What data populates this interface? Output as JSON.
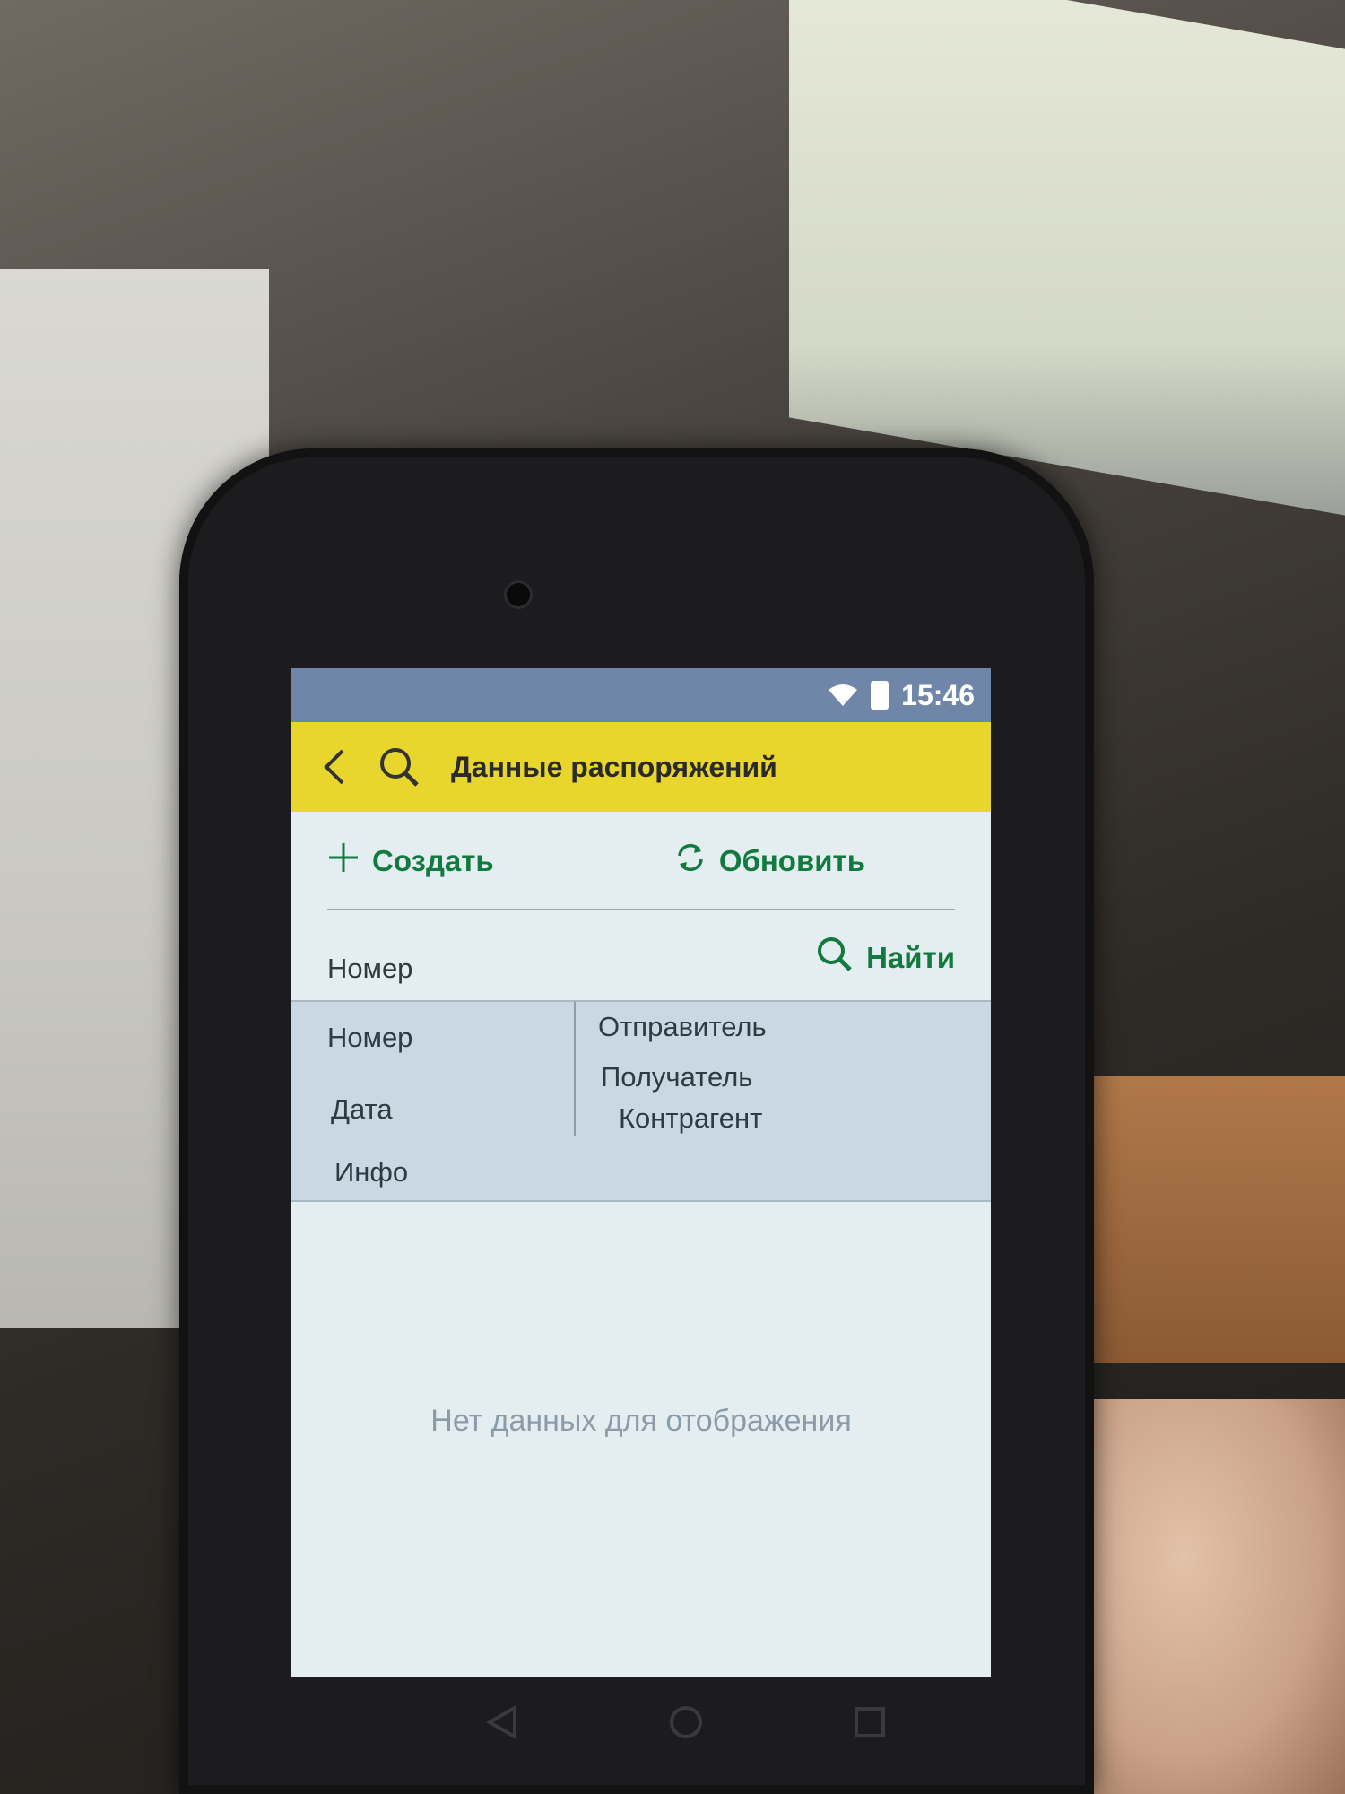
{
  "status_bar": {
    "time": "15:46",
    "icons": [
      "wifi-icon",
      "battery-icon"
    ]
  },
  "header": {
    "title": "Данные распоряжений",
    "background_color": "#e8d62d",
    "icons": [
      "back-icon",
      "search-icon"
    ]
  },
  "toolbar": {
    "create_label": "Создать",
    "refresh_label": "Обновить",
    "accent_color": "#137a3f"
  },
  "search": {
    "field_value": "Номер",
    "find_label": "Найти"
  },
  "list_columns": {
    "left": [
      "Номер",
      "Дата",
      "Инфо"
    ],
    "right": [
      "Отправитель",
      "Получатель",
      "Контрагент"
    ]
  },
  "list": {
    "empty_message": "Нет данных для отображения"
  },
  "navigation": {
    "icons": [
      "back-triangle-icon",
      "home-circle-icon",
      "recents-square-icon"
    ]
  }
}
